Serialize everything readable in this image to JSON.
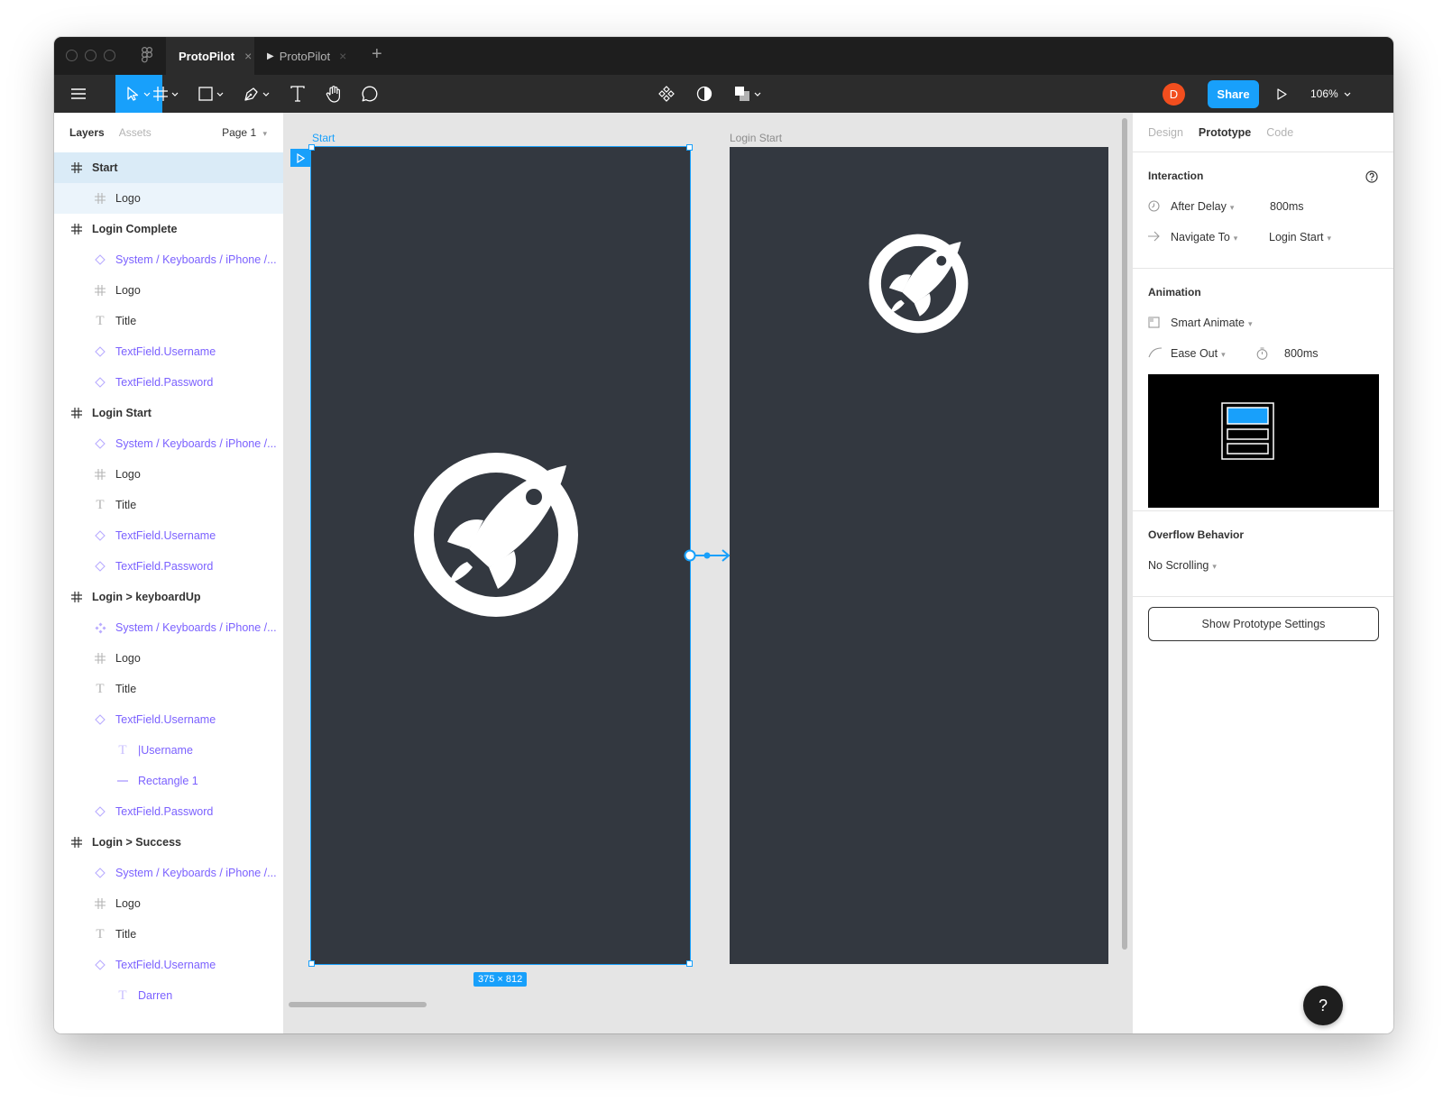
{
  "titlebar": {
    "tabs": [
      {
        "label": "ProtoPilot",
        "close": "×"
      },
      {
        "label": "ProtoPilot",
        "close": "×"
      }
    ],
    "add_tab": "+"
  },
  "toolbar": {
    "tools": [
      "menu-icon",
      "move-icon",
      "frame-icon",
      "shape-icon",
      "pen-icon",
      "text-icon",
      "hand-icon",
      "comment-icon"
    ],
    "center_tools": [
      "component-icon",
      "mask-icon",
      "boolean-icon"
    ],
    "avatar_initial": "D",
    "share_label": "Share",
    "zoom": "106%",
    "accent": "#18a0fb"
  },
  "layers_panel": {
    "tabs": [
      "Layers",
      "Assets"
    ],
    "page": "Page 1",
    "items": [
      {
        "label": "Start",
        "kind": "frame",
        "level": 0,
        "state": "selected"
      },
      {
        "label": "Logo",
        "kind": "frame",
        "level": 1,
        "state": "child"
      },
      {
        "label": "Login Complete",
        "kind": "frame",
        "level": 0
      },
      {
        "label": "System / Keyboards / iPhone /...",
        "kind": "instance",
        "level": 1
      },
      {
        "label": "Logo",
        "kind": "frame",
        "level": 1
      },
      {
        "label": "Title",
        "kind": "text",
        "level": 1
      },
      {
        "label": "TextField.Username",
        "kind": "instance",
        "level": 1
      },
      {
        "label": "TextField.Password",
        "kind": "instance",
        "level": 1
      },
      {
        "label": "Login Start",
        "kind": "frame",
        "level": 0
      },
      {
        "label": "System / Keyboards / iPhone /...",
        "kind": "instance",
        "level": 1
      },
      {
        "label": "Logo",
        "kind": "frame",
        "level": 1
      },
      {
        "label": "Title",
        "kind": "text",
        "level": 1
      },
      {
        "label": "TextField.Username",
        "kind": "instance",
        "level": 1
      },
      {
        "label": "TextField.Password",
        "kind": "instance",
        "level": 1
      },
      {
        "label": "Login > keyboardUp",
        "kind": "frame",
        "level": 0
      },
      {
        "label": "System / Keyboards / iPhone /...",
        "kind": "component",
        "level": 1
      },
      {
        "label": "Logo",
        "kind": "frame",
        "level": 1
      },
      {
        "label": "Title",
        "kind": "text",
        "level": 1
      },
      {
        "label": "TextField.Username",
        "kind": "instance",
        "level": 1
      },
      {
        "label": "|Username",
        "kind": "text-comp",
        "level": 2
      },
      {
        "label": "Rectangle 1",
        "kind": "line",
        "level": 2
      },
      {
        "label": "TextField.Password",
        "kind": "instance",
        "level": 1
      },
      {
        "label": "Login > Success",
        "kind": "frame",
        "level": 0
      },
      {
        "label": "System / Keyboards / iPhone /...",
        "kind": "instance",
        "level": 1
      },
      {
        "label": "Logo",
        "kind": "frame",
        "level": 1
      },
      {
        "label": "Title",
        "kind": "text",
        "level": 1
      },
      {
        "label": "TextField.Username",
        "kind": "instance",
        "level": 1
      },
      {
        "label": "Darren",
        "kind": "text-comp",
        "level": 2
      }
    ]
  },
  "canvas": {
    "frame_start_label": "Start",
    "frame_login_label": "Login Start",
    "dimensions": "375 × 812",
    "frame_color": "#333840"
  },
  "right_panel": {
    "tabs": [
      "Design",
      "Prototype",
      "Code"
    ],
    "interaction": {
      "title": "Interaction",
      "trigger": "After Delay",
      "delay": "800ms",
      "action": "Navigate To",
      "destination": "Login Start"
    },
    "animation": {
      "title": "Animation",
      "type": "Smart Animate",
      "easing": "Ease Out",
      "duration": "800ms"
    },
    "overflow": {
      "title": "Overflow Behavior",
      "value": "No Scrolling"
    },
    "settings_button": "Show Prototype Settings",
    "help": "?"
  }
}
